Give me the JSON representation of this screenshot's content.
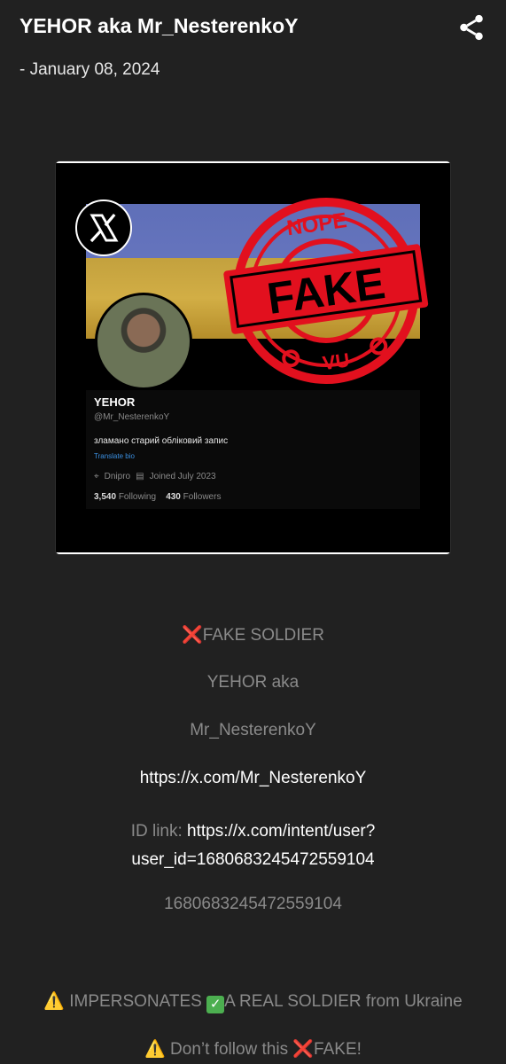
{
  "post": {
    "title": "YEHOR aka Mr_NesterenkoY",
    "date": "- January 08, 2024"
  },
  "image": {
    "profile_name": "YEHOR",
    "profile_handle": "@Mr_NesterenkoY",
    "bio": "зламано старий обліковий запис",
    "translate": "Translate bio",
    "location": "Dnipro",
    "joined": "Joined July 2023",
    "following_count": "3,540",
    "following_label": "Following",
    "followers_count": "430",
    "followers_label": "Followers",
    "stamp_top": "NOPE",
    "stamp_main": "FAKE",
    "stamp_bottom": "VU",
    "stamp_color": "#e2101e"
  },
  "body": {
    "fake_soldier": "FAKE SOLDIER",
    "name_line": "YEHOR aka",
    "handle_line": "Mr_NesterenkoY",
    "profile_link": "https://x.com/Mr_NesterenkoY",
    "id_label": "ID link: ",
    "id_link_1": "https://x.com/intent/user?",
    "id_link_2": "user_id=1680683245472559104",
    "user_id": "1680683245472559104",
    "impersonates": "IMPERSONATES",
    "real_soldier": "A REAL SOLDIER from Ukraine",
    "dont_follow": "Don’t follow this",
    "fake_end": "FAKE!"
  },
  "icons": {
    "share": "share-icon",
    "cross": "cross-mark-icon",
    "warning": "warning-icon",
    "check": "check-mark-icon"
  }
}
